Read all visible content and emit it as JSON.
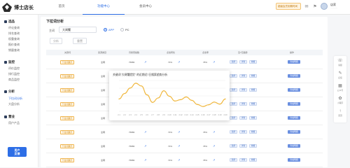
{
  "brand": {
    "name": "博士店长"
  },
  "topnav": [
    "首页",
    "功能中心",
    "会员中心"
  ],
  "topnav_active": 1,
  "user": {
    "vip_label": "超级会员到期时间",
    "name": "店家",
    "id": "··········"
  },
  "sidebar": {
    "groups": [
      {
        "title": "选品",
        "items": [
          "评论查询",
          "排名查询",
          "权重查询",
          "报价查询",
          "销量查询"
        ]
      },
      {
        "title": "监控",
        "items": [
          "评价监控",
          "排行监控",
          "商品监控"
        ]
      },
      {
        "title": "分析",
        "items": [
          "下拉词分析",
          "大盘分析"
        ]
      },
      {
        "title": "营业",
        "items": [
          "用户产品"
        ]
      }
    ],
    "active_item": "下拉词分析",
    "promo": [
      "用户",
      "反馈"
    ]
  },
  "page": {
    "title": "下拉词分析",
    "keyword_label": "主词",
    "keyword_value": "大闸蟹",
    "platforms": [
      "APP",
      "PC"
    ],
    "platform_selected": "APP",
    "buttons": [
      "分析",
      "重置"
    ]
  },
  "table": {
    "headers": [
      "关键词",
      "来源类目",
      "月搜索指数",
      "点击转化",
      "点击率",
      "近7日趋势",
      "操作"
    ],
    "rows": [
      {
        "keyword": "下拉词展示",
        "source": "全网",
        "index": "75880",
        "ctr": "73%",
        "conv": "78%"
      },
      {
        "keyword": "下拉词展示",
        "source": "全网",
        "index": "75880",
        "ctr": "73%",
        "conv": "78%"
      },
      {
        "keyword": "下拉词展示",
        "source": "全网",
        "index": "75880",
        "ctr": "73%",
        "conv": "78%"
      },
      {
        "keyword": "下拉词展示",
        "source": "全网",
        "index": "75880",
        "ctr": "73%",
        "conv": "78%"
      },
      {
        "keyword": "下拉词展示",
        "source": "全网",
        "index": "75880",
        "ctr": "73%",
        "conv": "78%"
      },
      {
        "keyword": "下拉词展示",
        "source": "全网",
        "index": "75880",
        "ctr": "73%",
        "conv": "78%"
      },
      {
        "keyword": "下拉词展示",
        "source": "全网",
        "index": "75880",
        "ctr": "73%",
        "conv": "78%"
      },
      {
        "keyword": "下拉词展示",
        "source": "全网",
        "index": "75880",
        "ctr": "73%",
        "conv": "78%"
      }
    ],
    "trend_icon": "trend-icon",
    "action_labels": [
      "趋势",
      "详情",
      "收藏"
    ],
    "op_label": "查看明细"
  },
  "popup": {
    "title": "关键词\"大闸蟹提货\" 的近期近7日搜索趋势分析"
  },
  "float_bar": [
    "客服",
    "反馈",
    "公众号",
    "小程序",
    "置顶"
  ],
  "chart_data": {
    "type": "line",
    "title": "关键词\"大闸蟹提货\" 的近期近7日搜索趋势分析",
    "x": [
      "2.1",
      "2.2",
      "2.3",
      "2.4",
      "2.5",
      "2.6",
      "2.7",
      "2.8",
      "2.9",
      "2.10",
      "2.11",
      "2.12",
      "2.13",
      "2.14",
      "2.15",
      "2.16",
      "2.17",
      "2.18",
      "2.19",
      "2.20"
    ],
    "series": [
      {
        "values": [
          3600,
          5200,
          6800,
          8200,
          7400,
          4800,
          2600,
          3900,
          6000,
          4400,
          3000,
          3400,
          4200,
          3200,
          2000,
          1400,
          1900,
          2700,
          2100,
          3600
        ]
      }
    ],
    "ylim": [
      0,
      9000
    ],
    "grid": true,
    "color": "#f0b840"
  }
}
